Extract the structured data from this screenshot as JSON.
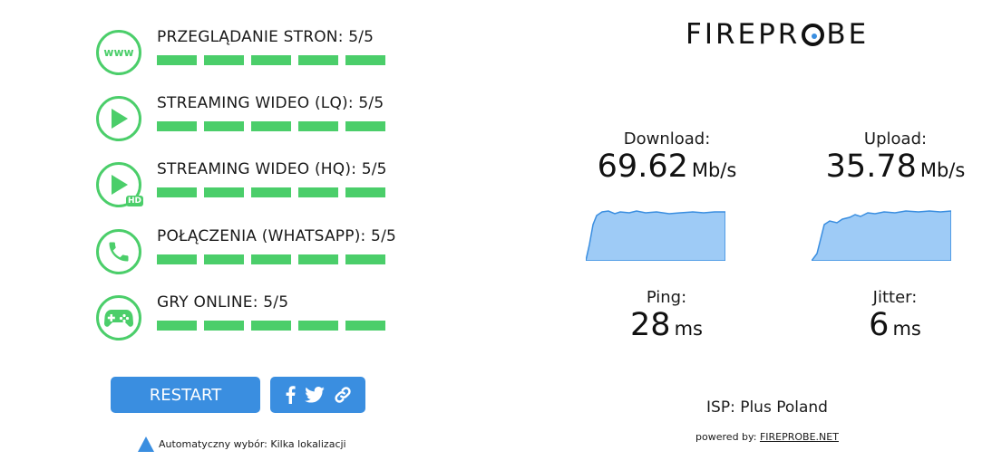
{
  "categories": [
    {
      "label": "PRZEGLĄDANIE STRON: 5/5",
      "icon": "www-icon",
      "score": 5,
      "max": 5
    },
    {
      "label": "STREAMING WIDEO (LQ): 5/5",
      "icon": "play-icon",
      "score": 5,
      "max": 5
    },
    {
      "label": "STREAMING WIDEO (HQ): 5/5",
      "icon": "play-hd-icon",
      "score": 5,
      "max": 5
    },
    {
      "label": "POŁĄCZENIA (WHATSAPP): 5/5",
      "icon": "phone-icon",
      "score": 5,
      "max": 5
    },
    {
      "label": "GRY ONLINE: 5/5",
      "icon": "gamepad-icon",
      "score": 5,
      "max": 5
    }
  ],
  "icons": {
    "www_text": "www",
    "hd_text": "HD"
  },
  "buttons": {
    "restart": "RESTART"
  },
  "share": [
    "facebook-icon",
    "twitter-icon",
    "link-icon"
  ],
  "server": {
    "text": "Automatyczny wybór: Kilka lokalizacji"
  },
  "brand": {
    "part1": "FIREPR",
    "part2": "BE"
  },
  "results": {
    "download": {
      "label": "Download:",
      "value": "69.62",
      "unit": "Mb/s"
    },
    "upload": {
      "label": "Upload:",
      "value": "35.78",
      "unit": "Mb/s"
    },
    "ping": {
      "label": "Ping:",
      "value": "28",
      "unit": "ms"
    },
    "jitter": {
      "label": "Jitter:",
      "value": "6",
      "unit": "ms"
    }
  },
  "isp": "ISP: Plus Poland",
  "powered": {
    "prefix": "powered by: ",
    "link": "FIREPROBE.NET"
  },
  "colors": {
    "green": "#4bce6a",
    "blue": "#3a8ee0",
    "graph_fill": "#9ecbf6",
    "graph_stroke": "#3a8ee0"
  }
}
